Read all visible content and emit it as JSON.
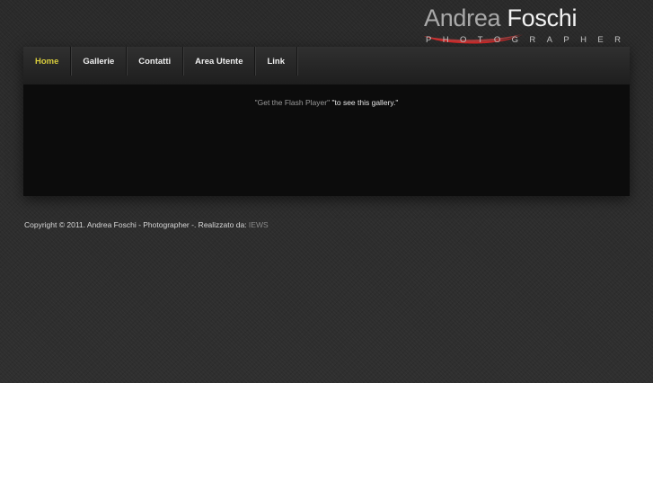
{
  "logo": {
    "first_name": "Andrea",
    "last_name": "Foschi",
    "subtitle": "PHOTOGRAPHER",
    "swoosh_color": "#d42a2a"
  },
  "nav": {
    "items": [
      {
        "label": "Home",
        "active": true
      },
      {
        "label": "Gallerie",
        "active": false
      },
      {
        "label": "Contatti",
        "active": false
      },
      {
        "label": "Area Utente",
        "active": false
      },
      {
        "label": "Link",
        "active": false
      }
    ],
    "active_color": "#d8cc3c"
  },
  "content": {
    "flash_link": "\"Get the Flash Player\"",
    "flash_message": " \"to see this gallery.\""
  },
  "footer": {
    "copyright": "Copyright © 2011. Andrea Foschi - Photographer -. Realizzato da: ",
    "credit_link": "IEWS"
  }
}
